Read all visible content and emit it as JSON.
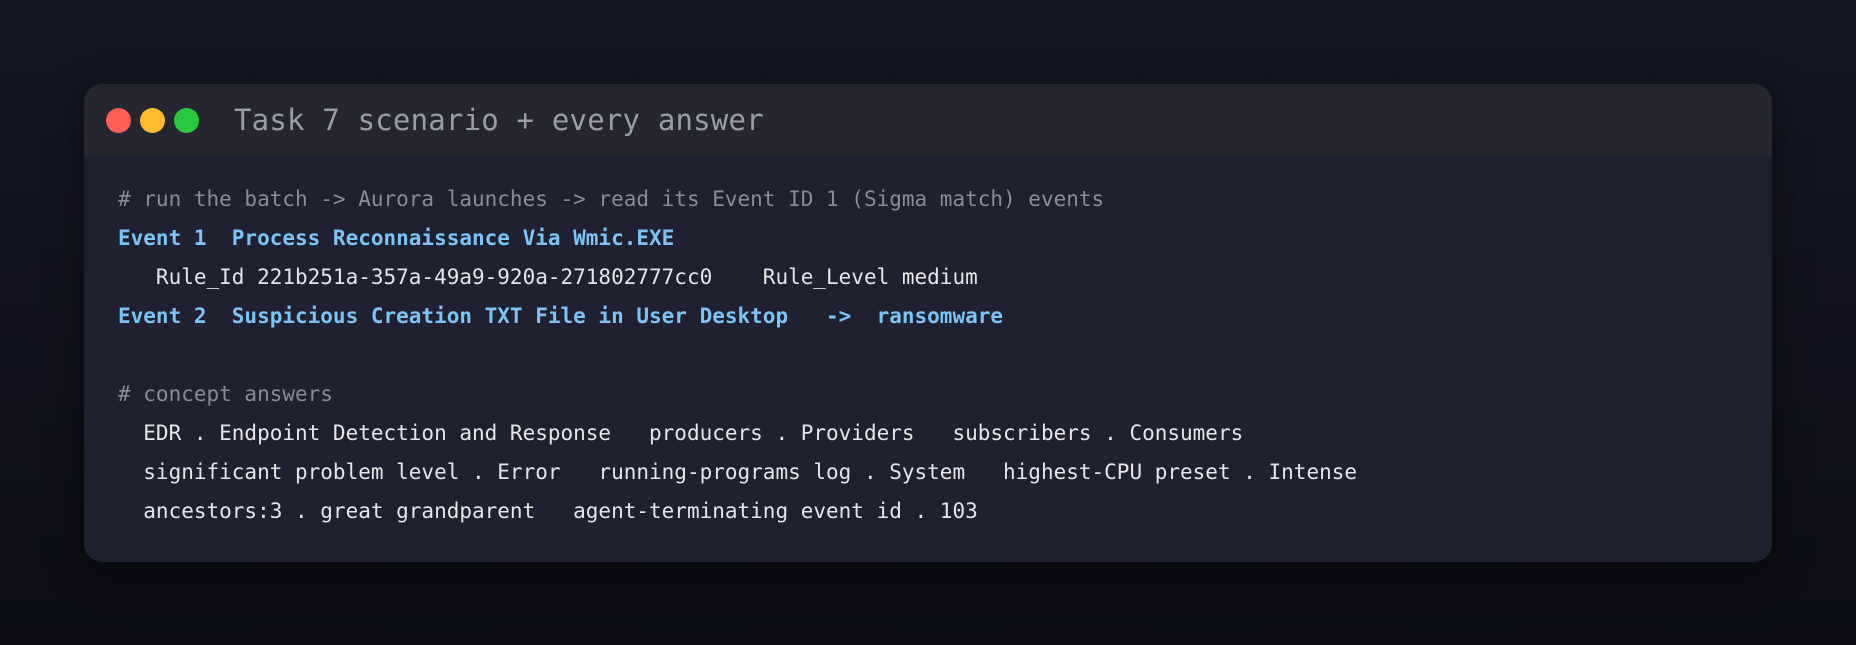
{
  "window": {
    "title": "Task 7 scenario + every answer",
    "controls": {
      "close_color": "#ff5f57",
      "minimize_color": "#febc2e",
      "maximize_color": "#28c840"
    }
  },
  "terminal": {
    "lines": {
      "comment_run": "# run the batch -> Aurora launches -> read its Event ID 1 (Sigma match) events",
      "event1": "Event 1  Process Reconnaissance Via Wmic.EXE",
      "event1_detail": "   Rule_Id 221b251a-357a-49a9-920a-271802777cc0    Rule_Level medium",
      "event2": "Event 2  Suspicious Creation TXT File in User Desktop   ->  ransomware",
      "comment_concepts": "# concept answers",
      "answers1": "  EDR . Endpoint Detection and Response   producers . Providers   subscribers . Consumers",
      "answers2": "  significant problem level . Error   running-programs log . System   highest-CPU preset . Intense",
      "answers3": "  ancestors:3 . great grandparent   agent-terminating event id . 103"
    }
  },
  "colors": {
    "comment": "#8a8c97",
    "event": "#7cc4f5",
    "text": "#e6e6ea"
  }
}
